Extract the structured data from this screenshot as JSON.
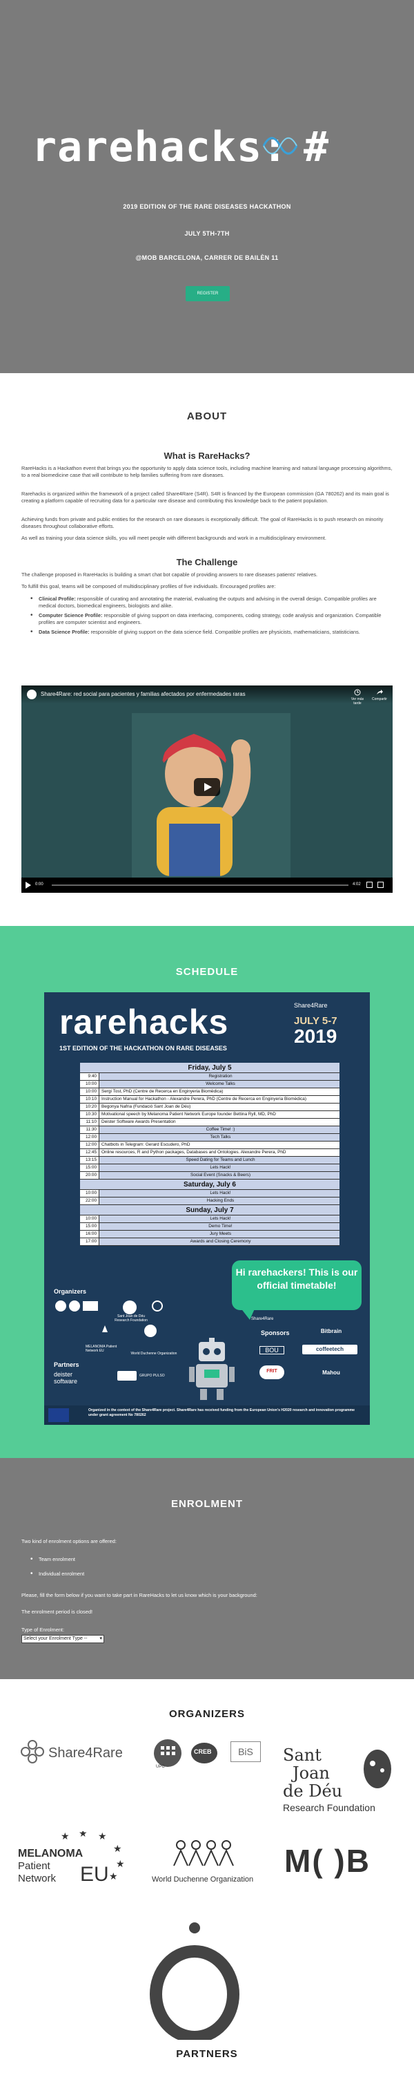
{
  "hero": {
    "logo_text": "rarehacks:",
    "logo_hash": "#",
    "edition": "2019 EDITION OF THE RARE DISEASES HACKATHON",
    "dates": "JULY 5TH-7TH",
    "venue": "@MOB BARCELONA, CARRER DE BAILÈN 11",
    "register_label": "REGISTER"
  },
  "about": {
    "title": "ABOUT",
    "what_title": "What is RareHacks?",
    "p1": "RareHacks is a Hackathon event that brings you the opportunity to apply data science tools, including machine learning and natural language processing algorithms, to a real biomedicine case that will contribute to help families suffering from rare diseases.",
    "p2": "Rarehacks is organized within the framework of a project called Share4Rare (S4R). S4R is financed by the European commission (GA 780262) and its main goal is creating a platform capable of recruiting data for a particular rare disease and contributing this knowledge back to the patient population.",
    "p3": "Achieving funds from private and public entities for the research on rare diseases is exceptionally difficult. The goal of RareHacks is to push research on minority diseases throughout collaborative efforts.",
    "p4": "As well as training your data science skills, you will meet people with different backgrounds and work in a multidisciplinary environment.",
    "challenge_title": "The Challenge",
    "c1": "The challenge proposed in RareHacks is building a smart chat bot capable of providing answers to rare diseases patients' relatives.",
    "c2": "To fulfill this goal, teams will be composed of multidisciplinary profiles of five individuals. Encouraged profiles are:",
    "profiles": [
      {
        "name": "Clinical Profile:",
        "text": "responsible of curating and annotating the material, evaluating the outputs and advising in the overall design. Compatible profiles are medical doctors, biomedical engineers, biologists and alike."
      },
      {
        "name": "Computer Science Profile:",
        "text": "responsible of giving support on data interfacing, components, coding strategy, code analysis and organization. Compatible profiles are computer scientist and engineers."
      },
      {
        "name": "Data Science Profile:",
        "text": "responsible of giving support on the data science field. Compatible profiles are physicists, mathematicians, statisticians."
      }
    ],
    "video": {
      "title": "Share4Rare: red social para pacientes y familias afectados por enfermedades raras",
      "watch_later": "Ver más tarde",
      "share": "Compartir",
      "current_time": "0:00",
      "duration": "4:02"
    }
  },
  "schedule": {
    "title": "SCHEDULE",
    "poster_title": "rarehacks",
    "poster_subtitle": "1ST EDITION OF THE HACKATHON ON RARE DISEASES",
    "brand": "Share4Rare",
    "dates": "JULY 5-7",
    "year": "2019",
    "days": [
      {
        "day": "Friday, July 5",
        "rows": [
          {
            "t": "9:40",
            "e": "Registration",
            "align": "center"
          },
          {
            "t": "10:00",
            "e": "Welcome Talks",
            "align": "center"
          },
          {
            "t": "10:00",
            "e": "Sergi Tost, PhD (Centre de Recerca en Enginyeria Biomèdica)",
            "align": "left"
          },
          {
            "t": "10:10",
            "e": "Instruction Manual for Hackathon - Alexandre Perera, PhD (Centre de Recerca en Enginyeria Biomèdica)",
            "align": "left"
          },
          {
            "t": "10:20",
            "e": "Begonya Nafria (Fundació Sant Joan de Déu)",
            "align": "left"
          },
          {
            "t": "10:30",
            "e": "Motivational speech by Melanoma Patient Network Europe founder Bettina Ryll, MD, PhD",
            "align": "left"
          },
          {
            "t": "11:10",
            "e": "Deister Software Awards Presentation",
            "align": "left"
          },
          {
            "t": "11:30",
            "e": "Coffee Time! :)",
            "align": "center"
          },
          {
            "t": "12:00",
            "e": "Tech Talks",
            "align": "center"
          },
          {
            "t": "12:00",
            "e": "Chatbots in Telegram: Gerard Escudero, PhD",
            "align": "left"
          },
          {
            "t": "12:45",
            "e": "Online resources, R and Python packages, Databases and Ontologies. Alexandre Perera, PhD",
            "align": "left"
          },
          {
            "t": "13:15",
            "e": "Speed Dating for Teams and Lunch",
            "align": "center"
          },
          {
            "t": "15:00",
            "e": "Lets Hack!",
            "align": "center"
          },
          {
            "t": "20:00",
            "e": "Social Event (Snacks & Beers)",
            "align": "center"
          }
        ]
      },
      {
        "day": "Saturday, July 6",
        "rows": [
          {
            "t": "10:00",
            "e": "Lets Hack!",
            "align": "center"
          },
          {
            "t": "22:00",
            "e": "Hacking Ends",
            "align": "center"
          }
        ]
      },
      {
        "day": "Sunday, July 7",
        "rows": [
          {
            "t": "10:00",
            "e": "Lets Hack!",
            "align": "center"
          },
          {
            "t": "15:00",
            "e": "Demo Time!",
            "align": "center"
          },
          {
            "t": "16:00",
            "e": "Jury Meets",
            "align": "center"
          },
          {
            "t": "17:00",
            "e": "Awards and Closing Ceremony",
            "align": "center"
          }
        ]
      }
    ],
    "bubble": "Hi rarehackers! This is our official timetable!",
    "organizers_label": "Organizers",
    "sponsors_label": "Sponsors",
    "partners_label": "Partners",
    "poster_logos": {
      "sjd": "Sant Joan de Déu Research Foundation",
      "mpn": "MELANOMA Patient Network EU",
      "wdo": "World Duchenne Organization",
      "deister": "deister software",
      "gp": "GRUPO PULSO",
      "s4r": "Share4Rare",
      "bitbrain": "Bitbrain",
      "bou": "BOU",
      "coffeetech": "coffeetech",
      "frit": "FRIT",
      "mahou": "Mahou"
    },
    "footer": "Organized in the context of the Share4Rare project. Share4Rare has received funding from the European Union's H2020 research and innovation programme under grant agreement No 780262"
  },
  "enrolment": {
    "title": "ENROLMENT",
    "intro": "Two kind of enrolment options are offered:",
    "options": [
      "Team enrolment",
      "Individual enrolment"
    ],
    "instructions": "Please, fill the form below if you want to take part in RareHacks to let us know which is your background:",
    "closed": "The enrolment period is closed!",
    "type_label": "Type of Enrolment:",
    "select_value": "Select your Enrolment Type --"
  },
  "organizers": {
    "title": "ORGANIZERS",
    "share4rare": "Share4Rare",
    "upc": "UPC",
    "creb": "CREB",
    "bis": "BiS",
    "sjd": [
      "Sant",
      "Joan",
      "de Déu",
      "Research Foundation"
    ],
    "melanoma": [
      "MELANOMA",
      "Patient",
      "Network",
      "EU"
    ],
    "wdo": "World Duchenne Organization",
    "mob": "M( )B"
  },
  "partners": {
    "title": "PARTNERS"
  },
  "colors": {
    "hero_bg": "#7b7b7b",
    "accent_green": "#27ae86",
    "schedule_bg": "#55cc96",
    "poster_navy": "#1d3b5a"
  }
}
